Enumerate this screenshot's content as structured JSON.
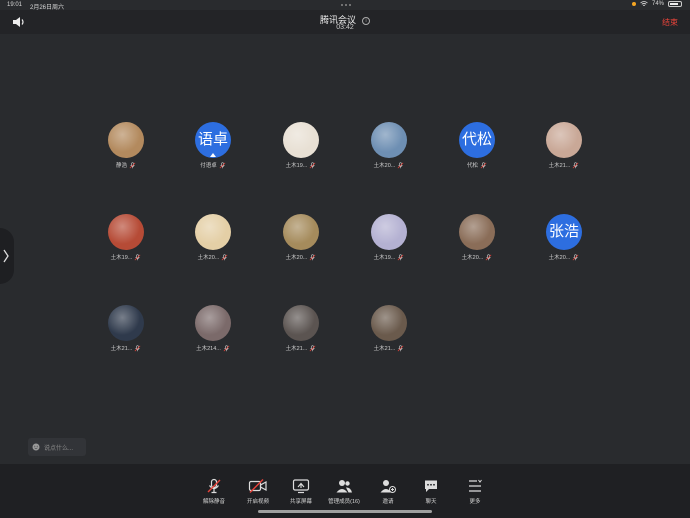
{
  "status_bar": {
    "time": "19:01",
    "date": "2月26日周六",
    "battery": "74%"
  },
  "header": {
    "title": "腾讯会议",
    "timer": "03:42",
    "end_label": "结束"
  },
  "participants": [
    {
      "name": "静浩",
      "avatar_type": "image",
      "color": "#b38a5e"
    },
    {
      "name": "付语卓",
      "avatar_type": "text",
      "avatar_text": "语卓",
      "color": "#2d6ee0"
    },
    {
      "name": "土木19...",
      "avatar_type": "image",
      "color": "#e8e0d4"
    },
    {
      "name": "土木20...",
      "avatar_type": "image",
      "color": "#6e8fb3"
    },
    {
      "name": "代松",
      "avatar_type": "text",
      "avatar_text": "代松",
      "color": "#2d6ee0"
    },
    {
      "name": "土木21...",
      "avatar_type": "image",
      "color": "#c9a897"
    },
    {
      "name": "土木19...",
      "avatar_type": "image",
      "color": "#b64b36"
    },
    {
      "name": "土木20...",
      "avatar_type": "image",
      "color": "#e4cfa6"
    },
    {
      "name": "土木20...",
      "avatar_type": "image",
      "color": "#a58b5c"
    },
    {
      "name": "土木19...",
      "avatar_type": "image",
      "color": "#b4b1d2"
    },
    {
      "name": "土木20...",
      "avatar_type": "image",
      "color": "#8a6d58"
    },
    {
      "name": "土木20...",
      "avatar_type": "text",
      "avatar_text": "张浩",
      "color": "#2d6ee0"
    },
    {
      "name": "土木21...",
      "avatar_type": "image",
      "color": "#2f3a4c"
    },
    {
      "name": "土木214...",
      "avatar_type": "image",
      "color": "#7b6a6a"
    },
    {
      "name": "土木21...",
      "avatar_type": "image",
      "color": "#5b5451"
    },
    {
      "name": "土木21...",
      "avatar_type": "image",
      "color": "#6a5a4c"
    }
  ],
  "chat": {
    "placeholder": "说点什么..."
  },
  "toolbar": {
    "unmute": "解除静音",
    "start_video": "开启视频",
    "share_screen": "共享屏幕",
    "manage_members": "管理成员(16)",
    "invite": "邀请",
    "chat": "聊天",
    "more": "更多"
  },
  "colors": {
    "end": "#e8433a",
    "accent": "#2d6ee0",
    "background": "#292b2e"
  }
}
